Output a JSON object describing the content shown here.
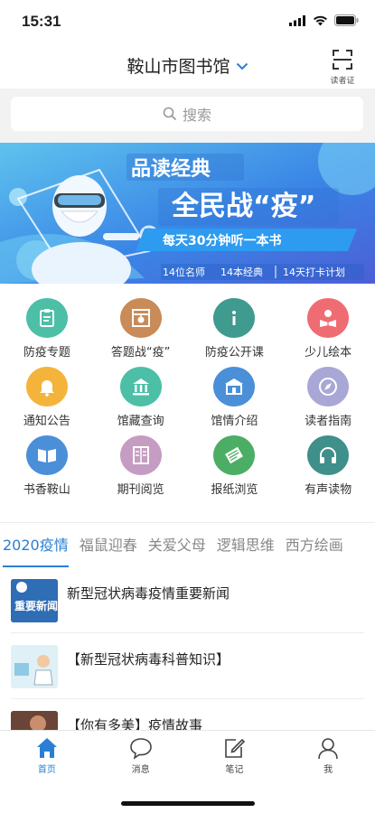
{
  "status": {
    "time": "15:31"
  },
  "header": {
    "title": "鞍山市图书馆",
    "scan_label": "读者证"
  },
  "search": {
    "placeholder": "搜索"
  },
  "banner": {
    "title1": "品读经典",
    "title2": "全民战“疫”",
    "slogan": "每天30分钟听一本书",
    "sub1": "14位名师",
    "sub2": "14本经典",
    "sub3": "14天打卡计划"
  },
  "grid": [
    {
      "label": "防疫专题",
      "icon": "clipboard-icon",
      "color": "#4cbfa6"
    },
    {
      "label": "答题战“疫”",
      "icon": "quiz-icon",
      "color": "#c98b57"
    },
    {
      "label": "防疫公开课",
      "icon": "info-icon",
      "color": "#3f9a8f"
    },
    {
      "label": "少儿绘本",
      "icon": "reading-child-icon",
      "color": "#f06c73"
    },
    {
      "label": "通知公告",
      "icon": "bell-icon",
      "color": "#f4b43b"
    },
    {
      "label": "馆藏查询",
      "icon": "library-building-icon",
      "color": "#4cbfa6"
    },
    {
      "label": "馆情介绍",
      "icon": "museum-icon",
      "color": "#4a8fd8"
    },
    {
      "label": "读者指南",
      "icon": "compass-icon",
      "color": "#a9a7d6"
    },
    {
      "label": "书香鞍山",
      "icon": "open-book-icon",
      "color": "#4a8fd8"
    },
    {
      "label": "期刊阅览",
      "icon": "magazine-icon",
      "color": "#c59cc2"
    },
    {
      "label": "报纸浏览",
      "icon": "newspaper-icon",
      "color": "#4cae65"
    },
    {
      "label": "有声读物",
      "icon": "headphones-icon",
      "color": "#3f8f8b"
    }
  ],
  "tabs": [
    "2020疫情",
    "福鼠迎春",
    "关爱父母",
    "逻辑思维",
    "西方绘画"
  ],
  "list": [
    {
      "title": "新型冠状病毒疫情重要新闻",
      "thumb_text": "重要新闻"
    },
    {
      "title": "【新型冠状病毒科普知识】",
      "thumb_text": ""
    },
    {
      "title": "【你有多美】疫情故事",
      "thumb_text": ""
    }
  ],
  "tabbar": [
    {
      "label": "首页",
      "icon": "home-icon"
    },
    {
      "label": "消息",
      "icon": "message-icon"
    },
    {
      "label": "笔记",
      "icon": "note-icon"
    },
    {
      "label": "我",
      "icon": "profile-icon"
    }
  ],
  "colors": {
    "accent": "#2a7fd4",
    "search_bg": "#f2f2f2"
  }
}
